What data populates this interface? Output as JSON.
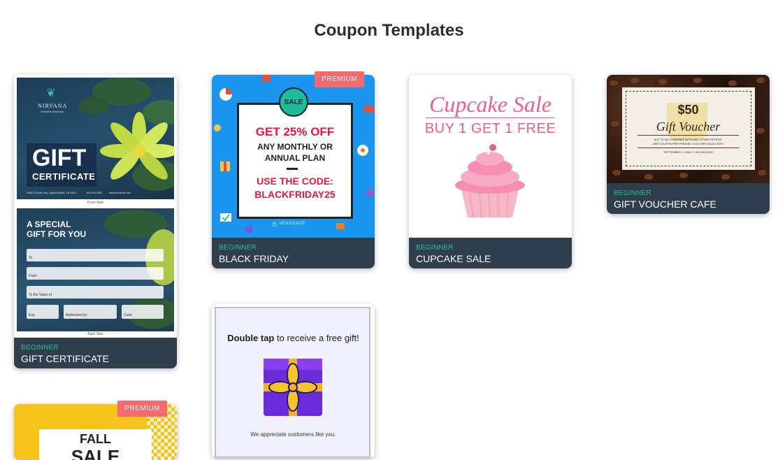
{
  "page": {
    "title": "Coupon Templates"
  },
  "cards": [
    {
      "level": "BEGINNER",
      "name": "GIFT CERTIFICATE",
      "front": {
        "brand": "NIRVANA",
        "brand_sub": "Wellness Boutique",
        "big": "GIFT",
        "small": "CERTIFICATE",
        "address": "1400 S Ocean Hwy, Laguna Beach, CA 10012",
        "phone": "540-000-0000",
        "web": "www.hmsname.com",
        "side_label": "Front Side"
      },
      "back": {
        "headline_1": "A SPECIAL",
        "headline_2": "GIFT FOR YOU",
        "field_to": "To",
        "field_from": "From",
        "field_value": "To the Value of",
        "field_exp": "Exp",
        "field_auth": "Authorized by",
        "field_code": "Code",
        "side_label": "Back Side"
      }
    },
    {
      "level": "BEGINNER",
      "name": "BLACK FRIDAY",
      "premium": "PREMIUM",
      "design": {
        "badge": "SALE",
        "line1": "GET 25% OFF",
        "line2": "ANY MONTHLY OR",
        "line3": "ANNUAL PLAN",
        "line4": "USE THE CODE:",
        "line5": "BLACKFRIDAY25",
        "brand": "VENNGAGE"
      }
    },
    {
      "level": "BEGINNER",
      "name": "CUPCAKE SALE",
      "design": {
        "title": "Cupcake Sale",
        "sub": "BUY 1 GET 1 FREE"
      }
    },
    {
      "level": "BEGINNER",
      "name": "GIFT VOUCHER CAFE",
      "design": {
        "amount": "$50",
        "title": "Gift Voucher",
        "fine1": "NOT TO BE COMBINED WITH ANY OTHER OFFERS.",
        "fine2": "ONE COUPON PER PERSON. VOUCHER VALID UNTIL",
        "fine3": "SEPTEMBER 1, 2016. T: 000-000-0000"
      }
    },
    {
      "design": {
        "bold": "Double tap",
        "rest": "to receive a free gift!",
        "thanks": "We appreciate customers like you."
      }
    },
    {
      "premium": "PREMIUM",
      "design": {
        "line1": "FALL",
        "line2": "SALE"
      }
    }
  ],
  "colors": {
    "footer": "#2f3e4c",
    "level": "#27c38b",
    "premium": "#f46a6f",
    "blue_bg": "#1a95f0",
    "red": "#e8173c",
    "pink": "#ec5f8e",
    "yellow": "#f6c31a"
  }
}
